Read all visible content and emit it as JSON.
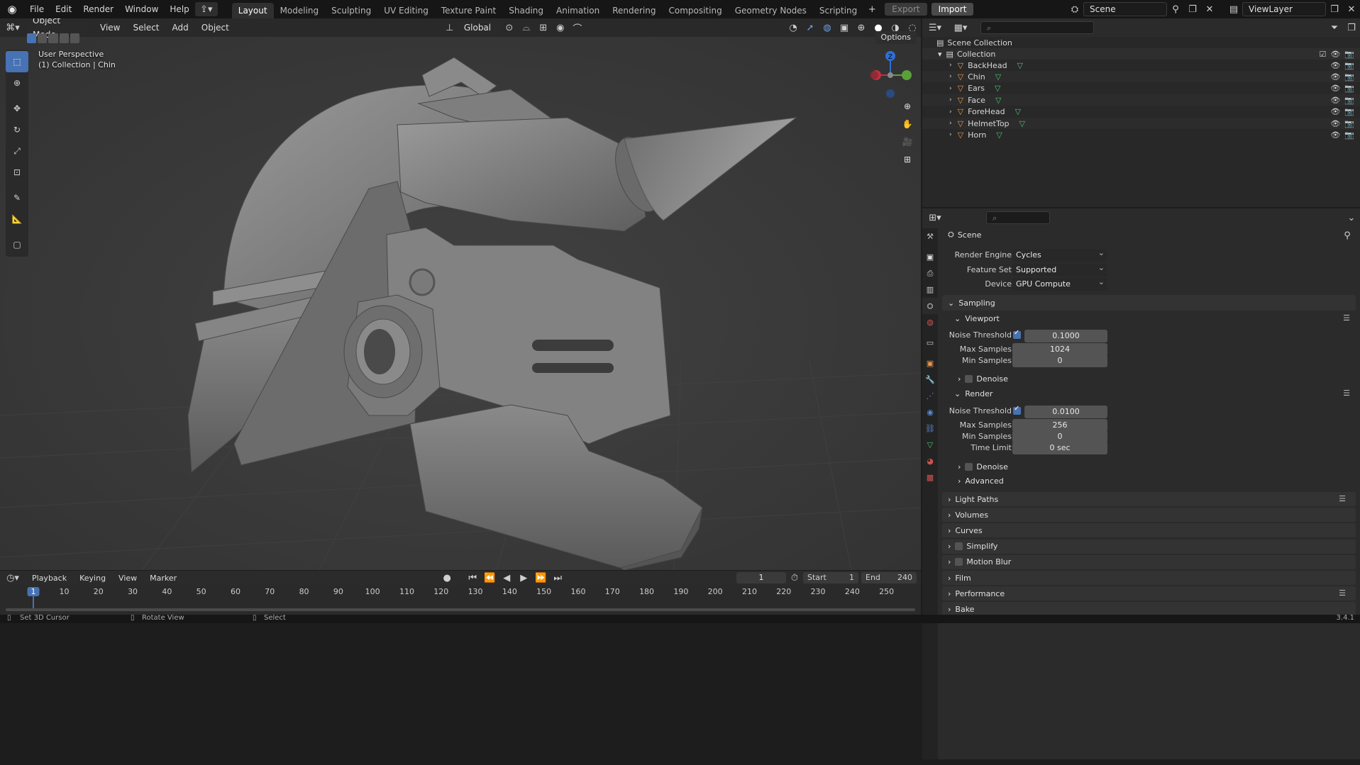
{
  "topbar": {
    "menus": [
      "File",
      "Edit",
      "Render",
      "Window",
      "Help"
    ],
    "workspaces": [
      "Layout",
      "Modeling",
      "Sculpting",
      "UV Editing",
      "Texture Paint",
      "Shading",
      "Animation",
      "Rendering",
      "Compositing",
      "Geometry Nodes",
      "Scripting"
    ],
    "active_workspace": "Layout",
    "export_label": "Export",
    "import_label": "Import",
    "scene_name": "Scene",
    "view_layer": "ViewLayer"
  },
  "viewport": {
    "mode": "Object Mode",
    "menus": [
      "View",
      "Select",
      "Add",
      "Object"
    ],
    "transform_orientation": "Global",
    "options_label": "Options",
    "overlay_title": "User Perspective",
    "overlay_sub": "(1) Collection | Chin",
    "gizmo_axes": {
      "x": "X",
      "y": "Y",
      "z": "Z"
    }
  },
  "outliner": {
    "root": "Scene Collection",
    "collection": "Collection",
    "objects": [
      "BackHead",
      "Chin",
      "Ears",
      "Face",
      "ForeHead",
      "HelmetTop",
      "Horn"
    ]
  },
  "properties": {
    "context": "Scene",
    "render_engine_label": "Render Engine",
    "render_engine": "Cycles",
    "feature_set_label": "Feature Set",
    "feature_set": "Supported",
    "device_label": "Device",
    "device": "GPU Compute",
    "sampling": "Sampling",
    "viewport": "Viewport",
    "noise_threshold_label": "Noise Threshold",
    "viewport_noise": "0.1000",
    "max_samples_label": "Max Samples",
    "viewport_max": "1024",
    "min_samples_label": "Min Samples",
    "viewport_min": "0",
    "denoise_label": "Denoise",
    "render": "Render",
    "render_noise": "0.0100",
    "render_max": "256",
    "render_min": "0",
    "time_limit_label": "Time Limit",
    "time_limit": "0 sec",
    "advanced": "Advanced",
    "panels": [
      "Light Paths",
      "Volumes",
      "Curves",
      "Simplify",
      "Motion Blur",
      "Film",
      "Performance",
      "Bake"
    ]
  },
  "timeline": {
    "menus": [
      "Playback",
      "Keying",
      "View",
      "Marker"
    ],
    "current_frame": "1",
    "start_label": "Start",
    "start": "1",
    "end_label": "End",
    "end": "240",
    "ticks": [
      "1",
      "10",
      "20",
      "30",
      "40",
      "50",
      "60",
      "70",
      "80",
      "90",
      "100",
      "110",
      "120",
      "130",
      "140",
      "150",
      "160",
      "170",
      "180",
      "190",
      "200",
      "210",
      "220",
      "230",
      "240",
      "250"
    ]
  },
  "status": {
    "left": "Set 3D Cursor",
    "mid": "Rotate View",
    "right": "Select",
    "version": "3.4.1"
  },
  "colors": {
    "accent": "#4772b3",
    "mesh_icon": "#e8964a",
    "vert_icon": "#4fbf7a"
  }
}
